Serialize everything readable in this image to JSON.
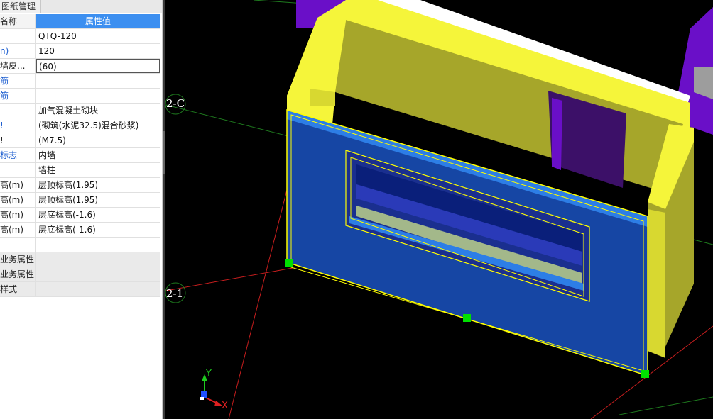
{
  "tab": {
    "label": "图纸管理"
  },
  "property_table": {
    "header": {
      "name": "名称",
      "value": "属性值"
    },
    "rows": [
      {
        "name": "",
        "value": "QTQ-120",
        "blue": false,
        "gray": false
      },
      {
        "name": "n)",
        "value": "120",
        "blue": true,
        "gray": false
      },
      {
        "name": "墙皮...",
        "value": "(60)",
        "blue": false,
        "gray": false,
        "focused": true
      },
      {
        "name": "筋",
        "value": "",
        "blue": true,
        "gray": false
      },
      {
        "name": "筋",
        "value": "",
        "blue": true,
        "gray": false
      },
      {
        "name": "",
        "value": "加气混凝土砌块",
        "blue": false,
        "gray": false
      },
      {
        "name": "!",
        "value": "(砌筑(水泥32.5)混合砂浆)",
        "blue": true,
        "gray": false
      },
      {
        "name": "!",
        "value": "(M7.5)",
        "blue": false,
        "gray": false
      },
      {
        "name": "标志",
        "value": "内墙",
        "blue": true,
        "gray": false
      },
      {
        "name": "",
        "value": "墙柱",
        "blue": false,
        "gray": false
      },
      {
        "name": "高(m)",
        "value": "层顶标高(1.95)",
        "blue": false,
        "gray": false
      },
      {
        "name": "高(m)",
        "value": "层顶标高(1.95)",
        "blue": false,
        "gray": false
      },
      {
        "name": "高(m)",
        "value": "层底标高(-1.6)",
        "blue": false,
        "gray": false
      },
      {
        "name": "高(m)",
        "value": "层底标高(-1.6)",
        "blue": false,
        "gray": false
      },
      {
        "name": "",
        "value": "",
        "blue": false,
        "gray": false
      },
      {
        "name": "业务属性",
        "value": "",
        "blue": false,
        "gray": true
      },
      {
        "name": "业务属性",
        "value": "",
        "blue": false,
        "gray": true
      },
      {
        "name": "样式",
        "value": "",
        "blue": false,
        "gray": true
      }
    ]
  },
  "viewport": {
    "grid_labels": {
      "c": "2-C",
      "one": "2-1"
    },
    "ucs": {
      "x_label": "X",
      "y_label": "Y"
    },
    "colors": {
      "background": "#000000",
      "wall_yellow": "#f5f53a",
      "wall_olive": "#a6a62a",
      "wall_blue": "#1646a4",
      "wall_blue_top": "#2d7ee6",
      "purple": "#6a0fc8",
      "grip_green": "#00e000",
      "grid_red": "#c81e1e",
      "grid_green": "#1e7a1e"
    }
  }
}
